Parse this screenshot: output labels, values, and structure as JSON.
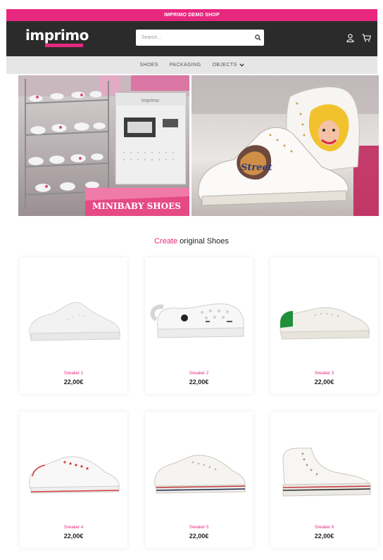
{
  "topbar": {
    "text": "IMPRIMO DEMO SHOP"
  },
  "header": {
    "logo": "imprimo",
    "search_placeholder": "Search...",
    "icons": [
      "user-icon",
      "cart-icon"
    ]
  },
  "nav": {
    "items": [
      {
        "label": "SHOES"
      },
      {
        "label": "PACKAGING"
      },
      {
        "label": "OBJECTS",
        "has_dropdown": true
      }
    ]
  },
  "hero": {
    "left_caption": "MINIBABY SHOES",
    "machine_label": "imprimo",
    "shoe_art_text": "Street"
  },
  "section": {
    "title_accent": "Create",
    "title_rest": " original Shoes"
  },
  "products": [
    {
      "name": "Sneaker 1",
      "price": "22,00€"
    },
    {
      "name": "Sneaker 2",
      "price": "22,00€"
    },
    {
      "name": "Sneaker 3",
      "price": "22,00€"
    },
    {
      "name": "Sneaker 4",
      "price": "22,00€"
    },
    {
      "name": "Sneaker 5",
      "price": "22,00€"
    },
    {
      "name": "Sneaker 6",
      "price": "22,00€"
    }
  ],
  "colors": {
    "brand": "#e8277f",
    "header": "#2b2b2b",
    "nav": "#e6e6e6"
  }
}
